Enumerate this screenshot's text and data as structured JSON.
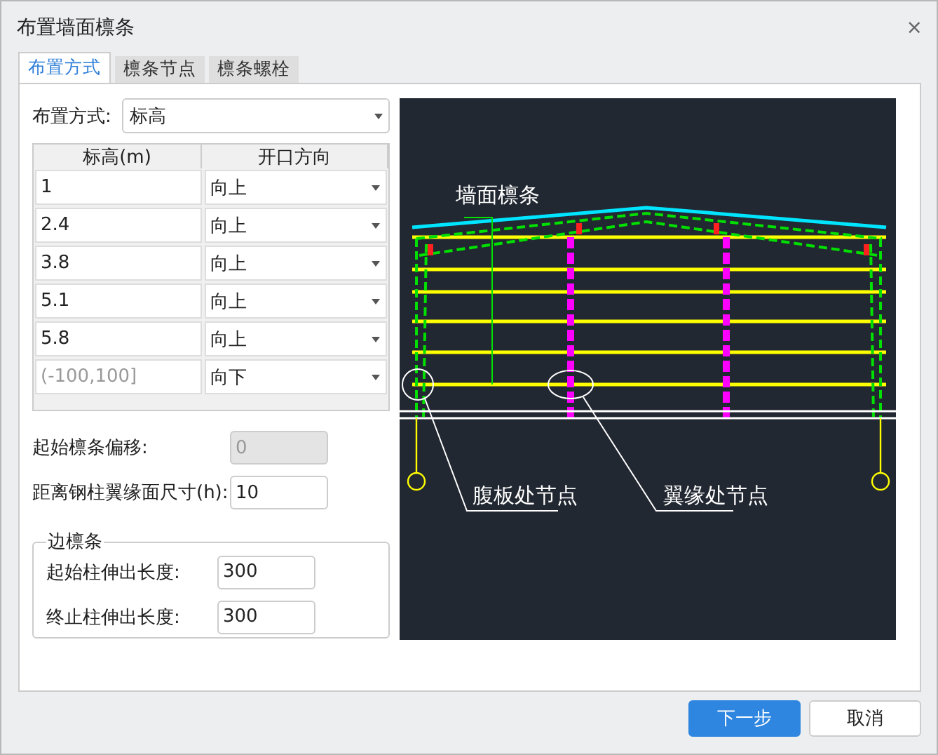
{
  "window": {
    "title": "布置墙面檩条",
    "close": "×"
  },
  "tabs": [
    {
      "label": "布置方式",
      "selected": true
    },
    {
      "label": "檩条节点",
      "selected": false
    },
    {
      "label": "檩条螺栓",
      "selected": false
    }
  ],
  "layout_mode": {
    "label": "布置方式:",
    "value": "标高"
  },
  "table": {
    "columns": [
      "标高(m)",
      "开口方向"
    ],
    "rows": [
      {
        "elevation": "1",
        "direction": "向上"
      },
      {
        "elevation": "2.4",
        "direction": "向上"
      },
      {
        "elevation": "3.8",
        "direction": "向上"
      },
      {
        "elevation": "5.1",
        "direction": "向上"
      },
      {
        "elevation": "5.8",
        "direction": "向上"
      },
      {
        "placeholder": "(-100,100]",
        "direction": "向下"
      }
    ]
  },
  "fields": [
    {
      "label": "起始檩条偏移:",
      "value": "0",
      "disabled": true
    },
    {
      "label": "距离钢柱翼缘面尺寸(h):",
      "value": "10",
      "disabled": false
    }
  ],
  "edge_purlin": {
    "title": "边檩条",
    "fields": [
      {
        "label": "起始柱伸出长度:",
        "value": "300"
      },
      {
        "label": "终止柱伸出长度:",
        "value": "300"
      }
    ]
  },
  "diagram": {
    "labels": [
      "墙面檩条",
      "腹板处节点",
      "翼缘处节点"
    ]
  },
  "buttons": [
    {
      "label": "下一步",
      "kind": "primary"
    },
    {
      "label": "取消",
      "kind": "secondary"
    }
  ]
}
